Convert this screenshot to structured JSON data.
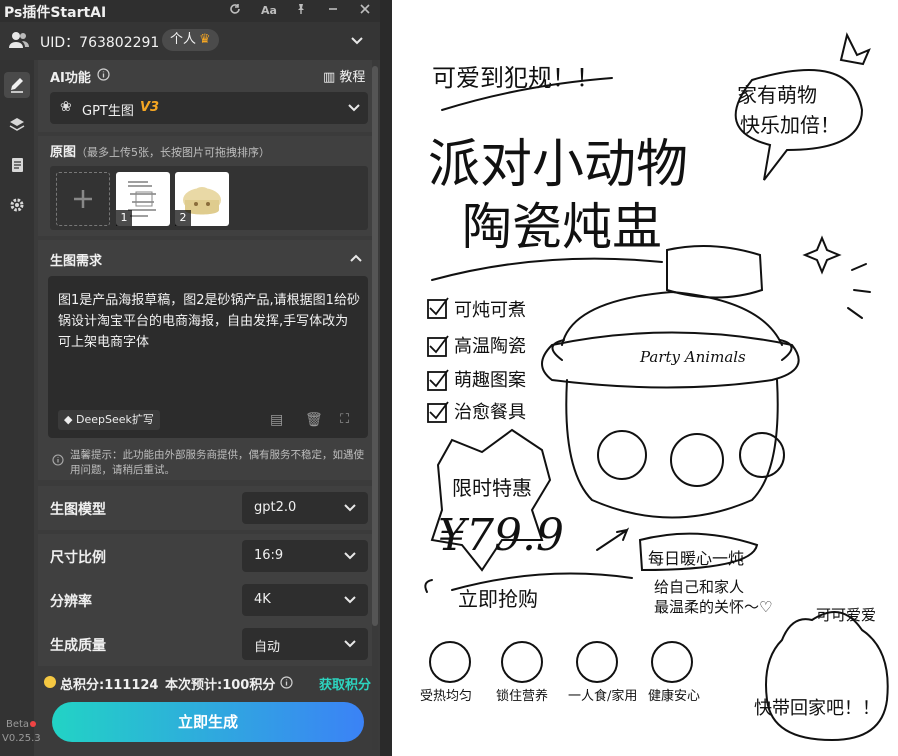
{
  "app": {
    "title": "Ps插件StartAI"
  },
  "uid": {
    "text": "UID：763802291",
    "badge": "个人"
  },
  "ai_function": {
    "label": "AI功能",
    "tutorial": "教程",
    "model_name": "GPT生图",
    "model_version": "V3"
  },
  "reference": {
    "label": "原图",
    "hint": "（最多上传5张，长按图片可拖拽排序）",
    "thumbs": [
      "1",
      "2"
    ]
  },
  "prompt": {
    "label": "生图需求",
    "text": "图1是产品海报草稿，图2是砂锅产品,请根据图1给砂锅设计淘宝平台的电商海报，自由发挥,手写体改为可上架电商字体",
    "deepseek": "DeepSeek扩写"
  },
  "notice": "温馨提示：此功能由外部服务商提供，偶有服务不稳定，如遇使用问题，请稍后重试。",
  "settings": [
    {
      "label": "生图模型",
      "value": "gpt2.0"
    },
    {
      "label": "尺寸比例",
      "value": "16:9"
    },
    {
      "label": "分辨率",
      "value": "4K"
    },
    {
      "label": "生成质量",
      "value": "自动"
    }
  ],
  "points": {
    "total": "总积分:111124",
    "estimate": "本次预计:100积分",
    "get": "获取积分"
  },
  "generate_label": "立即生成",
  "version": {
    "beta": "Beta",
    "num": "V0.25.3"
  },
  "poster": {
    "tagline": "可爱到犯规！！",
    "title_line1": "派对小动物",
    "title_line2": "陶瓷炖盅",
    "bubble": "家有萌物快乐加倍！",
    "features": [
      "可炖可煮",
      "高温陶瓷",
      "萌趣图案",
      "治愈餐具"
    ],
    "pot_text": "Party Animals",
    "sale_label": "限时特惠",
    "price": "¥79.9",
    "buy": "立即抢购",
    "warm_title": "每日暖心一炖",
    "warm_line1": "给自己和家人",
    "warm_line2": "最温柔的关怀～♡",
    "cute": "可可爱爱",
    "bottom_icons": [
      "受热均匀",
      "锁住营养",
      "一人食/家用",
      "健康安心"
    ],
    "take_home": "快带回家吧！！"
  }
}
